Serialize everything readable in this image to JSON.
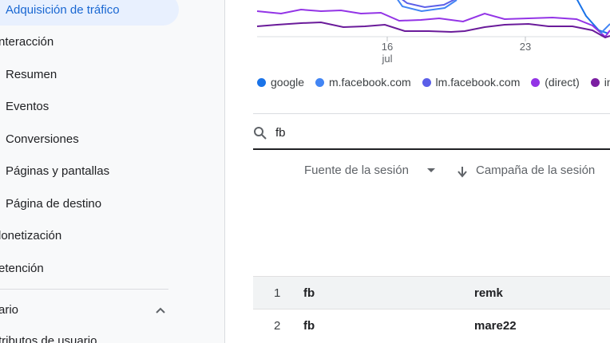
{
  "sidebar": {
    "items": [
      {
        "label": "Adquisición de tráfico"
      },
      {
        "label": "nteracción"
      },
      {
        "label": "Resumen"
      },
      {
        "label": "Eventos"
      },
      {
        "label": "Conversiones"
      },
      {
        "label": "Páginas y pantallas"
      },
      {
        "label": "Página de destino"
      },
      {
        "label": "lonetización"
      },
      {
        "label": "etención"
      },
      {
        "label": "ario"
      },
      {
        "label": "tributos de usuario"
      }
    ]
  },
  "chart": {
    "x_ticks": [
      {
        "day": "16",
        "month": "jul"
      },
      {
        "day": "23",
        "month": ""
      }
    ],
    "legend": [
      {
        "label": "google",
        "color": "#1a73e8"
      },
      {
        "label": "m.facebook.com",
        "color": "#4285f4"
      },
      {
        "label": "lm.facebook.com",
        "color": "#5b5fe8"
      },
      {
        "label": "(direct)",
        "color": "#9334e6"
      },
      {
        "label": "inst",
        "color": "#7b1fa2"
      }
    ]
  },
  "search": {
    "value": "fb"
  },
  "table": {
    "headers": [
      "Fuente de la sesión",
      "Campaña de la sesión"
    ],
    "rows": [
      {
        "num": "1",
        "source": "fb",
        "campaign": "remk"
      },
      {
        "num": "2",
        "source": "fb",
        "campaign": "mare22"
      }
    ]
  },
  "colors": {
    "accent": "#1967d2",
    "active_bg": "#e8f0fe",
    "line_light_purple": "#9334e6",
    "line_dark_purple": "#6a1b9a",
    "line_blue": "#4285f4"
  }
}
